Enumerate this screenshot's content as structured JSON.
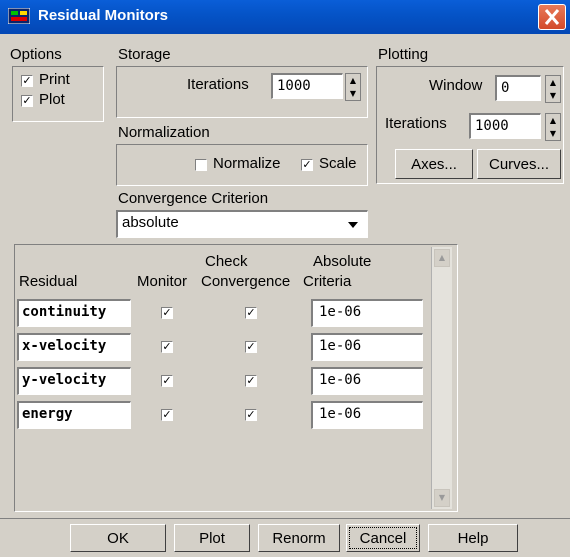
{
  "window": {
    "title": "Residual Monitors",
    "close_glyph": "✕",
    "icon": "app-window-icon"
  },
  "options": {
    "label": "Options",
    "print": {
      "label": "Print",
      "checked": true
    },
    "plot": {
      "label": "Plot",
      "checked": true
    }
  },
  "storage": {
    "label": "Storage",
    "iterations_label": "Iterations",
    "iterations_value": "1000"
  },
  "plotting": {
    "label": "Plotting",
    "window_label": "Window",
    "window_value": "0",
    "iterations_label": "Iterations",
    "iterations_value": "1000",
    "axes_button": "Axes...",
    "curves_button": "Curves..."
  },
  "normalization": {
    "label": "Normalization",
    "normalize": {
      "label": "Normalize",
      "checked": false
    },
    "scale": {
      "label": "Scale",
      "checked": true
    }
  },
  "convergence": {
    "label": "Convergence Criterion",
    "selected": "absolute"
  },
  "table": {
    "headers": {
      "residual": "Residual",
      "monitor": "Monitor",
      "check": "Check",
      "convergence": "Convergence",
      "absolute": "Absolute",
      "criteria": "Criteria"
    },
    "rows": [
      {
        "name": "continuity",
        "monitor": true,
        "check": true,
        "criteria": "1e-06"
      },
      {
        "name": "x-velocity",
        "monitor": true,
        "check": true,
        "criteria": "1e-06"
      },
      {
        "name": "y-velocity",
        "monitor": true,
        "check": true,
        "criteria": "1e-06"
      },
      {
        "name": "energy",
        "monitor": true,
        "check": true,
        "criteria": "1e-06"
      }
    ]
  },
  "buttons": {
    "ok": "OK",
    "plot": "Plot",
    "renorm": "Renorm",
    "cancel": "Cancel",
    "help": "Help"
  },
  "glyphs": {
    "check": "✓",
    "up": "▲",
    "down": "▼"
  }
}
